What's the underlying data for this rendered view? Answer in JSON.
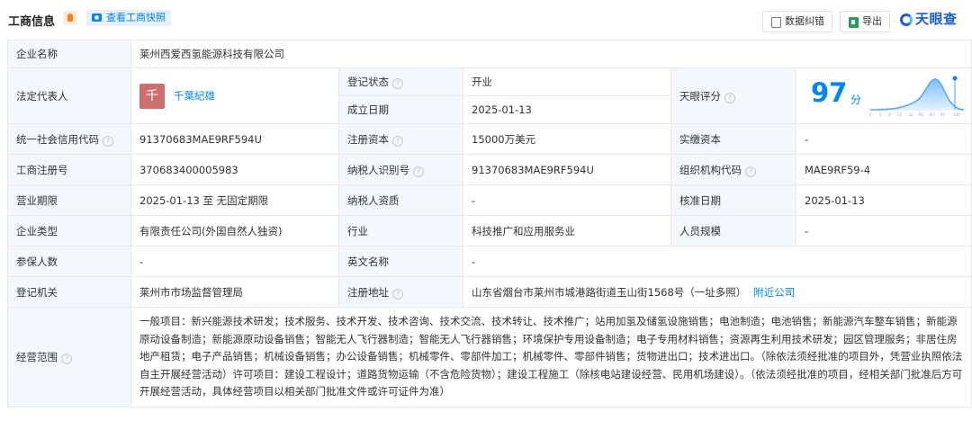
{
  "header": {
    "title": "工商信息",
    "snapshot_label": "查看工商快照",
    "correction_label": "数据纠错",
    "export_label": "导出",
    "brand": "天眼查"
  },
  "company": {
    "name_label": "企业名称",
    "name": "莱州西爱西氢能源科技有限公司",
    "legal_rep_label": "法定代表人",
    "legal_rep_avatar": "千",
    "legal_rep": "千葉紀雄",
    "reg_status_label": "登记状态",
    "reg_status": "开业",
    "found_date_label": "成立日期",
    "found_date": "2025-01-13",
    "rating_label": "天眼评分",
    "rating": "97",
    "rating_unit": "分",
    "credit_code_label": "统一社会信用代码",
    "credit_code": "91370683MAE9RF594U",
    "reg_capital_label": "注册资本",
    "reg_capital": "15000万美元",
    "paid_capital_label": "实缴资本",
    "paid_capital": "-",
    "reg_no_label": "工商注册号",
    "reg_no": "370683400005983",
    "tax_id_label": "纳税人识别号",
    "tax_id": "91370683MAE9RF594U",
    "org_code_label": "组织机构代码",
    "org_code": "MAE9RF59-4",
    "term_label": "营业期限",
    "term": "2025-01-13 至 无固定期限",
    "tax_qual_label": "纳税人资质",
    "tax_qual": "-",
    "approve_date_label": "核准日期",
    "approve_date": "2025-01-13",
    "type_label": "企业类型",
    "type": "有限责任公司(外国自然人独资)",
    "industry_label": "行业",
    "industry": "科技推广和应用服务业",
    "staff_label": "人员规模",
    "staff": "-",
    "insured_label": "参保人数",
    "insured": "-",
    "en_name_label": "英文名称",
    "en_name": "-",
    "authority_label": "登记机关",
    "authority": "莱州市市场监督管理局",
    "address_label": "注册地址",
    "address": "山东省烟台市莱州市城港路街道玉山街1568号（一址多照）",
    "nearby_label": "附近公司",
    "scope_label": "经营范围",
    "scope": "一般项目：新兴能源技术研发；技术服务、技术开发、技术咨询、技术交流、技术转让、技术推广；站用加氢及储氢设施销售；电池制造；电池销售；新能源汽车整车销售；新能源原动设备制造；新能源原动设备销售；智能无人飞行器制造；智能无人飞行器销售；环境保护专用设备制造；电子专用材料销售；资源再生利用技术研发；园区管理服务；非居住房地产租赁；电子产品销售；机械设备销售；办公设备销售；机械零件、零部件加工；机械零件、零部件销售；货物进出口；技术进出口。（除依法须经批准的项目外，凭营业执照依法自主开展经营活动）许可项目：建设工程设计；道路货物运输（不含危险货物）；建设工程施工（除核电站建设经营、民用机场建设）。（依法须经批准的项目，经相关部门批准后方可开展经营活动，具体经营项目以相关部门批准文件或许可证件为准）"
  },
  "colors": {
    "accent": "#0084ff",
    "label_bg": "#f2f8fe",
    "status_green": "#2bab2b",
    "avatar_bg": "#cf6e6e"
  },
  "icons": [
    "camera-icon",
    "edit-icon",
    "export-icon",
    "help-icon",
    "tianyancha-logo-icon"
  ]
}
